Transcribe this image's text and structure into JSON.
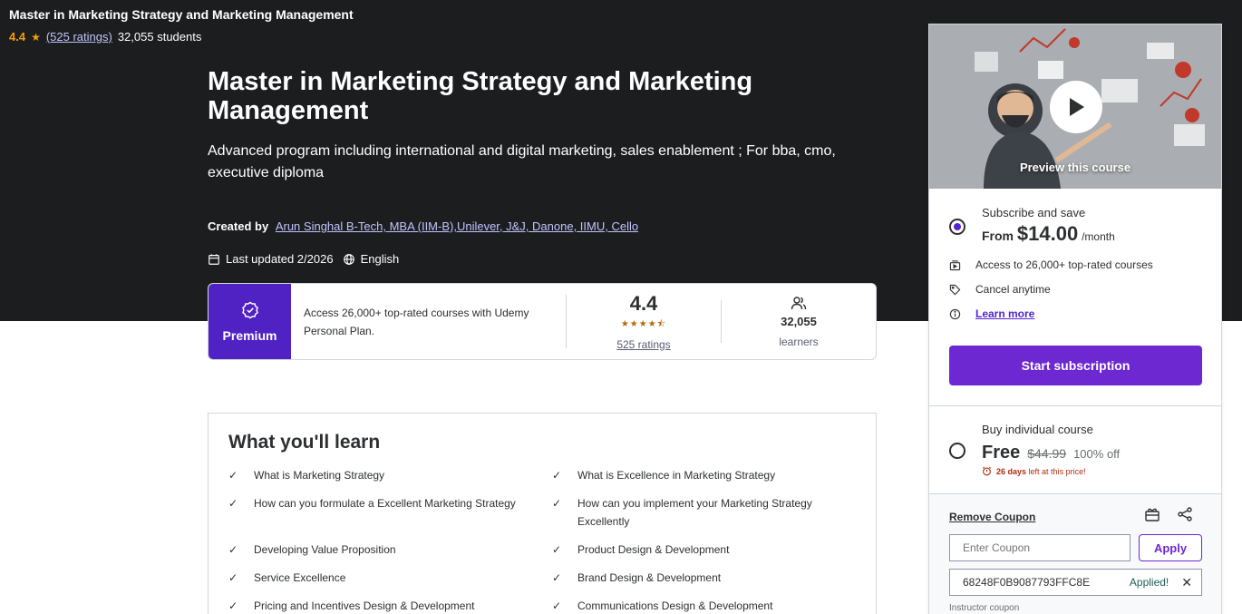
{
  "sticky": {
    "title": "Master in Marketing Strategy and Marketing Management",
    "rating": "4.4",
    "ratings_link": "(525 ratings)",
    "students": "32,055 students"
  },
  "course": {
    "title": "Master in Marketing Strategy and Marketing Management",
    "subtitle": "Advanced program including international and digital marketing, sales enablement ; For bba, cmo, executive diploma",
    "created_by_label": "Created by",
    "instructor": "Arun Singhal B-Tech, MBA (IIM-B),Unilever, J&J, Danone, IIMU, Cello",
    "last_updated": "Last updated 2/2026",
    "language": "English"
  },
  "premium": {
    "badge": "Premium",
    "text": "Access 26,000+ top-rated courses with Udemy Personal Plan.",
    "rating": "4.4",
    "stars": 4.5,
    "ratings_link": "525 ratings",
    "learners_count": "32,055",
    "learners_label": "learners"
  },
  "learn": {
    "title": "What you'll learn",
    "items": [
      "What is Marketing Strategy",
      "What is Excellence in Marketing Strategy",
      "How can you formulate a Excellent Marketing Strategy",
      "How can you implement your Marketing Strategy Excellently",
      "Developing Value Proposition",
      "Product Design & Development",
      "Service Excellence",
      "Brand Design & Development",
      "Pricing and Incentives Design & Development",
      "Communications Design & Development"
    ]
  },
  "sidebar": {
    "preview_label": "Preview this course",
    "subscribe": {
      "heading": "Subscribe and save",
      "from": "From",
      "price": "$14.00",
      "per": "/month",
      "feature_1": "Access to 26,000+ top-rated courses",
      "feature_2": "Cancel anytime",
      "learn_more": "Learn more",
      "button": "Start subscription"
    },
    "buy": {
      "heading": "Buy individual course",
      "price": "Free",
      "original": "$44.99",
      "discount": "100% off",
      "timer_days": "26 days",
      "timer_rest": "left at this price!"
    },
    "coupon": {
      "remove": "Remove Coupon",
      "placeholder": "Enter Coupon",
      "apply": "Apply",
      "code": "68248F0B9087793FFC8E",
      "applied": "Applied!",
      "instructor_note": "Instructor coupon"
    }
  },
  "colors": {
    "hero_bg": "#1c1d1f",
    "premium_purple": "#5022c3",
    "accent_purple": "#6d28d2",
    "rating_orange": "#f69c08",
    "link_lavender": "#c0c4fc"
  }
}
